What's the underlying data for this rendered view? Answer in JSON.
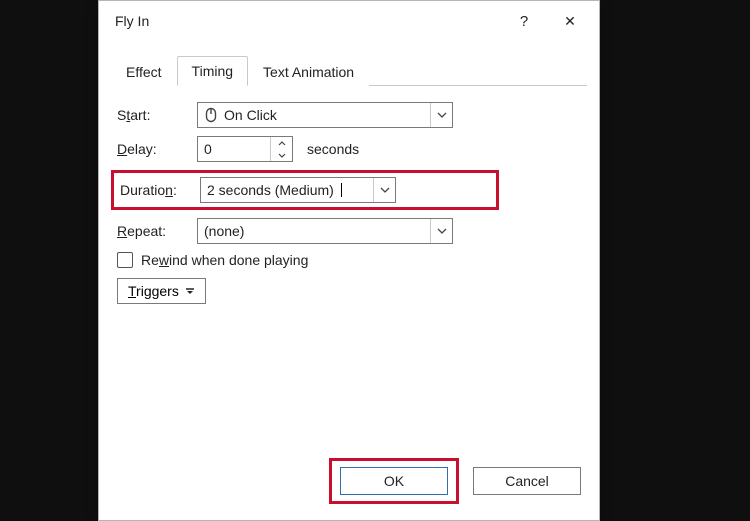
{
  "title": "Fly In",
  "help": "?",
  "close": "✕",
  "tabs": {
    "effect": "Effect",
    "timing": "Timing",
    "text_animation": "Text Animation"
  },
  "labels": {
    "start_pre": "S",
    "start_u": "t",
    "start_post": "art:",
    "delay_pre": "",
    "delay_u": "D",
    "delay_post": "elay:",
    "duration_pre": "Duratio",
    "duration_u": "n",
    "duration_post": ":",
    "repeat_pre": "",
    "repeat_u": "R",
    "repeat_post": "epeat:",
    "seconds": "seconds"
  },
  "values": {
    "start": "On Click",
    "delay": "0",
    "duration": "2 seconds (Medium)",
    "repeat": "(none)"
  },
  "rewind": {
    "pre": "Re",
    "u": "w",
    "post": "ind when done playing"
  },
  "triggers": {
    "pre": "",
    "u": "T",
    "post": "riggers"
  },
  "buttons": {
    "ok": "OK",
    "cancel": "Cancel"
  }
}
